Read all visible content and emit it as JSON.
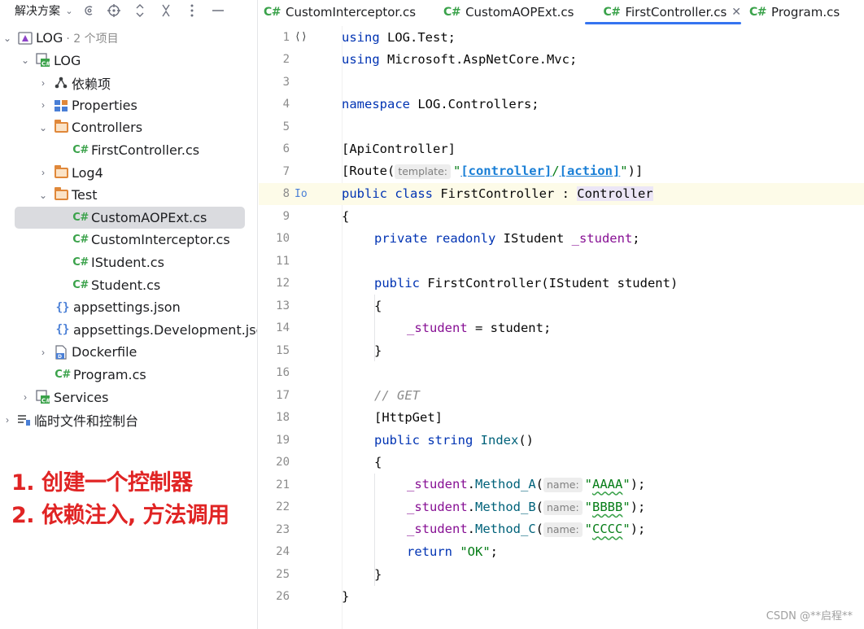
{
  "left_panel": {
    "title": "解决方案",
    "toolbar_icons": [
      "chevron-down-icon",
      "target-circle-icon",
      "crosshair-icon",
      "expand-collapse-icon",
      "close-x-icon",
      "more-vertical-icon",
      "minimize-icon"
    ],
    "tree": [
      {
        "label": "LOG",
        "sub": "· 2 个项目",
        "icon": "solution-icon",
        "expanded": true
      },
      {
        "label": "LOG",
        "icon": "csharp-project-icon",
        "expanded": true
      },
      {
        "label": "依赖项",
        "icon": "dependencies-icon",
        "expanded": false
      },
      {
        "label": "Properties",
        "icon": "properties-icon",
        "expanded": false
      },
      {
        "label": "Controllers",
        "icon": "folder-icon",
        "expanded": true
      },
      {
        "label": "FirstController.cs",
        "icon": "csharp-file-icon"
      },
      {
        "label": "Log4",
        "icon": "folder-icon",
        "expanded": false
      },
      {
        "label": "Test",
        "icon": "folder-icon",
        "expanded": true
      },
      {
        "label": "CustomAOPExt.cs",
        "icon": "csharp-file-icon",
        "selected": true
      },
      {
        "label": "CustomInterceptor.cs",
        "icon": "csharp-file-icon"
      },
      {
        "label": "IStudent.cs",
        "icon": "csharp-file-icon"
      },
      {
        "label": "Student.cs",
        "icon": "csharp-file-icon"
      },
      {
        "label": "appsettings.json",
        "icon": "json-file-icon"
      },
      {
        "label": "appsettings.Development.json",
        "icon": "json-file-icon"
      },
      {
        "label": "Dockerfile",
        "icon": "docker-file-icon",
        "expanded": false
      },
      {
        "label": "Program.cs",
        "icon": "csharp-file-icon"
      },
      {
        "label": "Services",
        "icon": "csharp-project-icon",
        "expanded": false
      },
      {
        "label": "临时文件和控制台",
        "icon": "scratches-icon",
        "expanded": false
      }
    ]
  },
  "annotation": {
    "line1": "1. 创建一个控制器",
    "line2": "2. 依赖注入, 方法调用",
    "color": "#e02424"
  },
  "tabs": [
    {
      "label": "CustomInterceptor.cs",
      "active": false
    },
    {
      "label": "CustomAOPExt.cs",
      "active": false
    },
    {
      "label": "FirstController.cs",
      "active": true
    },
    {
      "label": "Program.cs",
      "active": false
    }
  ],
  "tab_icon_text": "C#",
  "editor": {
    "current_line": 8,
    "lines": [
      {
        "n": "1"
      },
      {
        "n": "2"
      },
      {
        "n": "3"
      },
      {
        "n": "4"
      },
      {
        "n": "5"
      },
      {
        "n": "6"
      },
      {
        "n": "7"
      },
      {
        "n": "8"
      },
      {
        "n": "9"
      },
      {
        "n": "10"
      },
      {
        "n": "11"
      },
      {
        "n": "12"
      },
      {
        "n": "13"
      },
      {
        "n": "14"
      },
      {
        "n": "15"
      },
      {
        "n": "16"
      },
      {
        "n": "17"
      },
      {
        "n": "18"
      },
      {
        "n": "19"
      },
      {
        "n": "20"
      },
      {
        "n": "21"
      },
      {
        "n": "22"
      },
      {
        "n": "23"
      },
      {
        "n": "24"
      },
      {
        "n": "25"
      },
      {
        "n": "26"
      }
    ],
    "code": {
      "l1_using": "using",
      "l1_ns": " LOG.Test;",
      "l2_using": "using",
      "l2_ns": " Microsoft.AspNetCore.Mvc;",
      "l4_kw": "namespace",
      "l4_ns": " LOG.Controllers;",
      "l6": "[ApiController]",
      "l7_a": "[Route(",
      "l7_hint": "template:",
      "l7_q1": "\"",
      "l7_link1": "[controller]",
      "l7_slash": "/",
      "l7_link2": "[action]",
      "l7_q2": "\"",
      "l7_b": ")]",
      "l8_kw": "public class",
      "l8_name": " FirstController : ",
      "l8_base": "Controller",
      "l9": "{",
      "l10_kw": "private readonly",
      "l10_type": " IStudent ",
      "l10_field": "_student",
      "l10_end": ";",
      "l12_kw": "public",
      "l12_rest": " FirstController(IStudent student)",
      "l13": "{",
      "l14_field": "_student",
      "l14_rest": " = student;",
      "l15": "}",
      "l17": "// GET",
      "l18": "[HttpGet]",
      "l19_kw": "public string",
      "l19_name": "Index",
      "l19_end": "()",
      "l20": "{",
      "l21_field": "_student",
      "l21_dot": ".",
      "l21_m": "Method_A",
      "l21_open": "(",
      "l21_hint": "name:",
      "l21_q1": "\"",
      "l21_s": "AAAA",
      "l21_q2": "\"",
      "l21_end": ");",
      "l22_field": "_student",
      "l22_dot": ".",
      "l22_m": "Method_B",
      "l22_open": "(",
      "l22_hint": "name:",
      "l22_q1": "\"",
      "l22_s": "BBBB",
      "l22_q2": "\"",
      "l22_end": ");",
      "l23_field": "_student",
      "l23_dot": ".",
      "l23_m": "Method_C",
      "l23_open": "(",
      "l23_hint": "name:",
      "l23_q1": "\"",
      "l23_s": "CCCC",
      "l23_q2": "\"",
      "l23_end": ");",
      "l24_kw": "return",
      "l24_s": " \"OK\"",
      "l24_end": ";",
      "l25": "}",
      "l26": "}"
    },
    "gutter_l1": "⟨⟩",
    "gutter_l8": "Io"
  },
  "watermark": "CSDN @**启程**"
}
